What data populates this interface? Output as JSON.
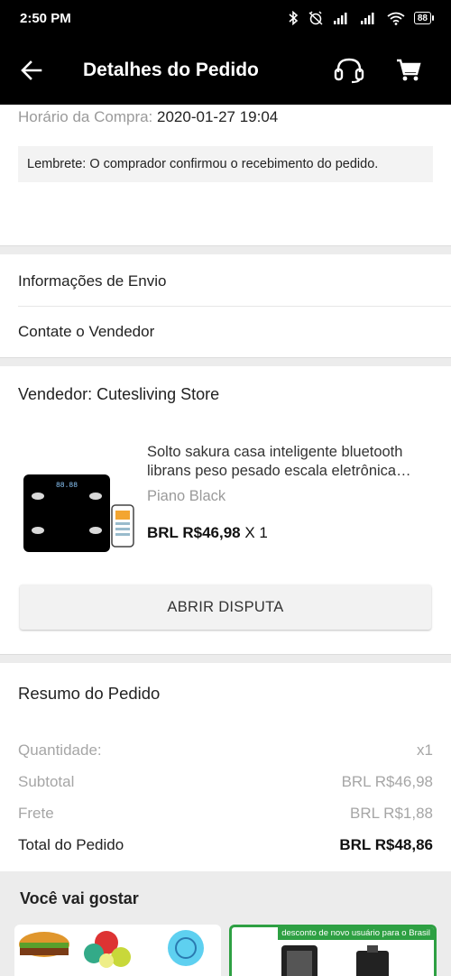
{
  "status_bar": {
    "time": "2:50 PM",
    "battery": "88"
  },
  "app_bar": {
    "title": "Detalhes do Pedido"
  },
  "order": {
    "purchase_time_label": "Horário da Compra:",
    "purchase_time_value": "2020-01-27 19:04",
    "reminder": "Lembrete: O comprador confirmou o recebimento do pedido."
  },
  "links": {
    "shipping_info": "Informações de Envio",
    "contact_seller": "Contate o Vendedor"
  },
  "seller": {
    "label": "Vendedor: Cutesliving Store"
  },
  "product": {
    "title": "Solto sakura casa inteligente bluetooth librans peso pesado escala eletrônica…",
    "variant": "Piano Black",
    "price": "BRL R$46,98",
    "qty": "X 1",
    "scale_display": "88.88"
  },
  "dispute_button": "ABRIR DISPUTA",
  "summary": {
    "title": "Resumo do Pedido",
    "quantity_label": "Quantidade:",
    "quantity_value": "x1",
    "subtotal_label": "Subtotal",
    "subtotal_value": "BRL R$46,98",
    "shipping_label": "Frete",
    "shipping_value": "BRL R$1,88",
    "total_label": "Total do Pedido",
    "total_value": "BRL R$48,86"
  },
  "recommendations": {
    "title": "Você vai gostar",
    "promo": "desconto de novo usuário para o Brasil"
  },
  "colors": {
    "accent_green": "#2ea043",
    "bar": "#000000",
    "bg_gray": "#ececec"
  }
}
